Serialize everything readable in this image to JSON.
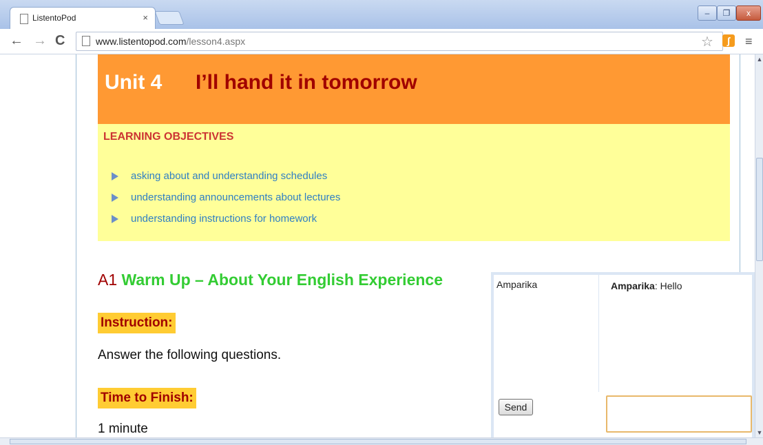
{
  "browser": {
    "tab_title": "ListentoPod",
    "tab_close": "×",
    "url_domain": "www.listentopod.com",
    "url_path": "/lesson4.aspx",
    "window_buttons": {
      "minimize": "–",
      "restore": "❐",
      "close": "x"
    }
  },
  "page": {
    "unit_number": "Unit 4",
    "unit_title": "I’ll hand it in tomorrow",
    "objectives": {
      "heading": "LEARNING OBJECTIVES",
      "items": [
        "asking about and understanding schedules",
        "understanding announcements about lectures",
        "understanding instructions for homework"
      ]
    },
    "section": {
      "number": "A1",
      "name": "Warm Up – About Your English Experience"
    },
    "instruction_label": "Instruction:",
    "instruction_text": "Answer the following questions.",
    "time_label": "Time to Finish:",
    "time_value": "1 minute"
  },
  "chat": {
    "users": [
      "Amparika"
    ],
    "messages": [
      {
        "sender": "Amparika",
        "text": ": Hello"
      }
    ],
    "send_label": "Send",
    "input_value": ""
  },
  "colors": {
    "header_orange": "#ff9933",
    "objectives_yellow": "#ffff99",
    "title_red": "#a00000",
    "section_green": "#33cc33",
    "label_bg": "#ffcc33"
  }
}
